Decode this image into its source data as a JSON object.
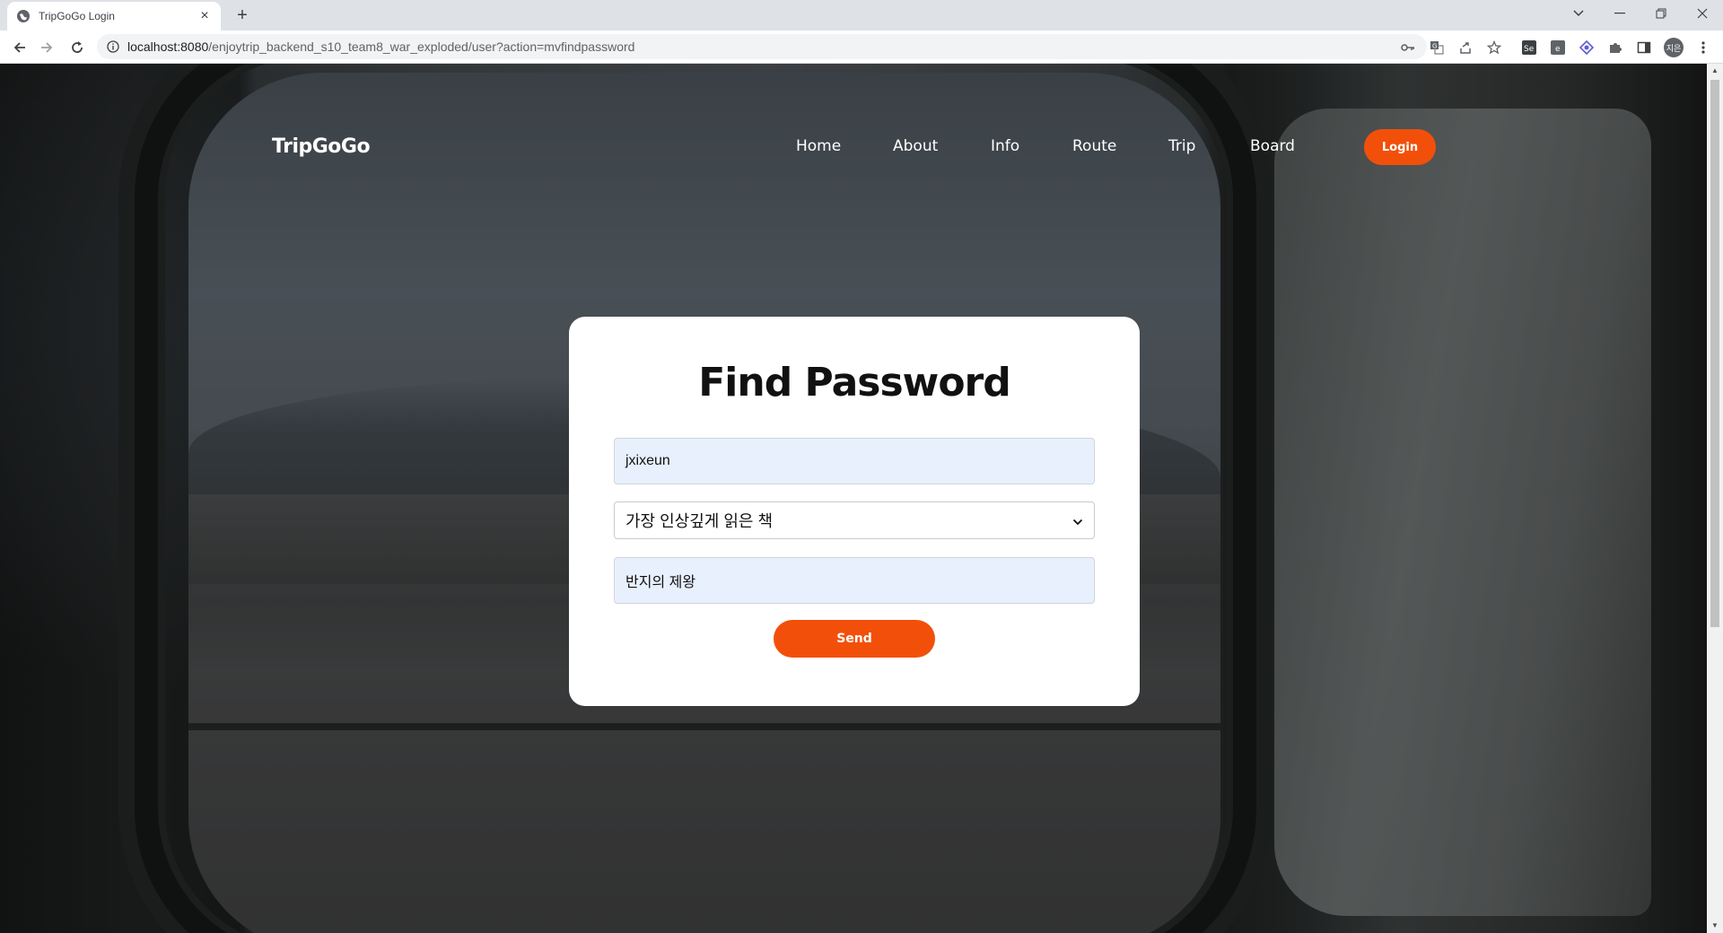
{
  "browser": {
    "tab_title": "TripGoGo Login",
    "url_host": "localhost:8080",
    "url_path": "/enjoytrip_backend_s10_team8_war_exploded/user?action=mvfindpassword",
    "profile_initials": "지은"
  },
  "site": {
    "brand": "TripGoGo",
    "nav": [
      "Home",
      "About",
      "Info",
      "Route",
      "Trip",
      "Board"
    ],
    "login_label": "Login"
  },
  "form": {
    "title": "Find Password",
    "user_id_value": "jxixeun",
    "question_selected": "가장 인상깊게 읽은 책",
    "answer_value": "반지의 제왕",
    "send_label": "Send"
  },
  "colors": {
    "accent": "#f2500a",
    "input_autofill_bg": "#e8f0fe"
  }
}
